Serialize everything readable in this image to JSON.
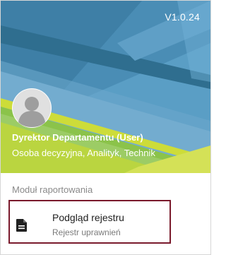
{
  "header": {
    "version": "V1.0.24",
    "user_name": "Dyrektor Departamentu (User)",
    "user_roles": "Osoba decyzyjna, Analityk, Technik"
  },
  "section": {
    "label": "Moduł raportowania"
  },
  "menu": {
    "items": [
      {
        "title": "Podgląd rejestru",
        "subtitle": "Rejestr uprawnień",
        "icon": "document-icon"
      }
    ]
  },
  "colors": {
    "header_blue": "#4f8fb5",
    "header_dark": "#2f6e8f",
    "accent_green": "#8bc34a",
    "accent_yellow": "#cddc39",
    "selection_border": "#7a1a2c"
  }
}
